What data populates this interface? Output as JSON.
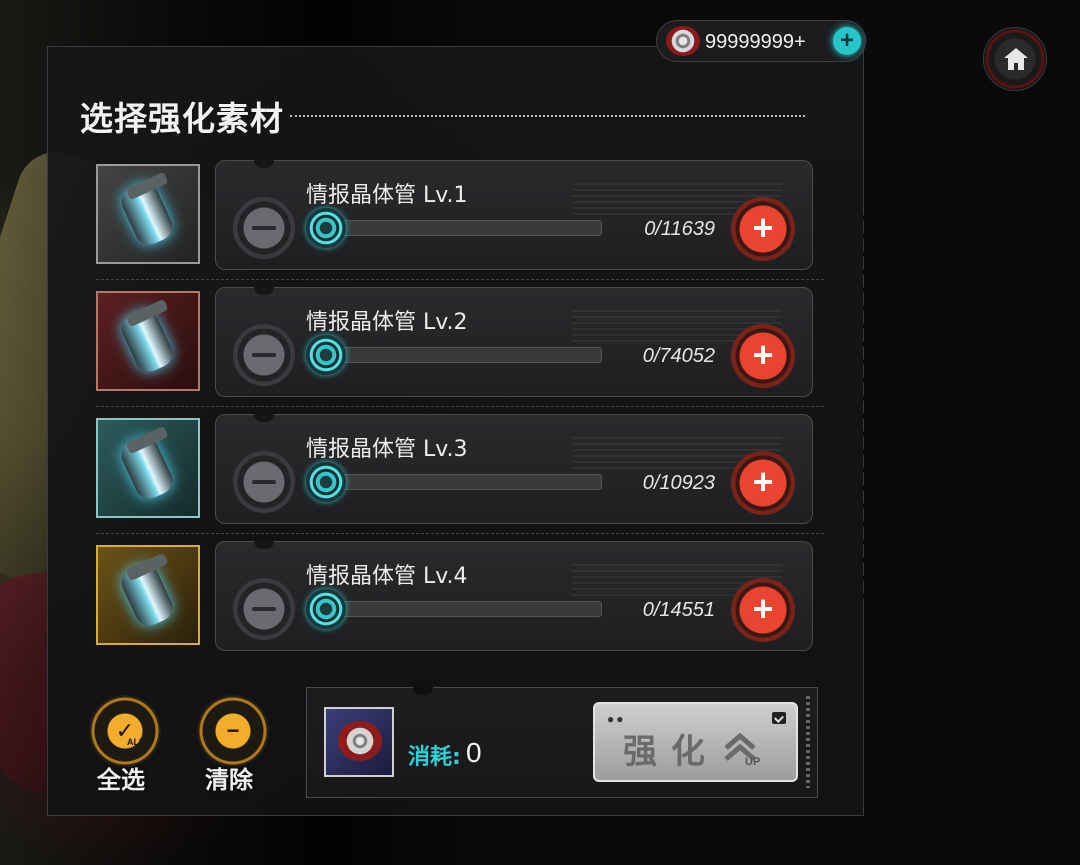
{
  "header": {
    "title": "选择强化素材"
  },
  "currency": {
    "icon": "chip-disc-icon",
    "value": "99999999+"
  },
  "items": [
    {
      "name": "情报晶体管 Lv.1",
      "count": "0/11639",
      "rarity_color": "#9a9a9a"
    },
    {
      "name": "情报晶体管 Lv.2",
      "count": "0/74052",
      "rarity_color": "#b3786a"
    },
    {
      "name": "情报晶体管 Lv.3",
      "count": "0/10923",
      "rarity_color": "#8ec5c5"
    },
    {
      "name": "情报晶体管 Lv.4",
      "count": "0/14551",
      "rarity_color": "#d8ad3a"
    }
  ],
  "actions": {
    "select_all_label": "全选",
    "select_all_badge": "ALL",
    "clear_label": "清除"
  },
  "cost": {
    "label": "消耗:",
    "value": "0"
  },
  "enhance": {
    "label": "强化",
    "up_badge": "UP",
    "dots": "●●"
  },
  "colors": {
    "accent_cyan": "#27c4c8",
    "plus_red": "#e8442f",
    "button_gold": "#f2ad2b"
  }
}
